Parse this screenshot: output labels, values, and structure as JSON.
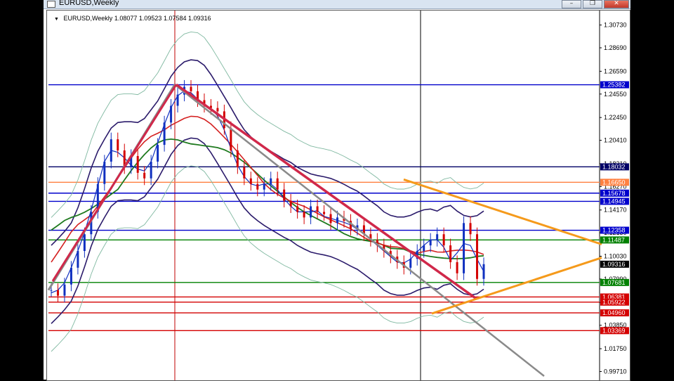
{
  "window": {
    "title": "EURUSD,Weekly",
    "controls": {
      "minimize": "–",
      "maximize": "❐",
      "close": "✕"
    }
  },
  "header": {
    "symbol": "EURUSD,Weekly",
    "open": "1.08077",
    "high": "1.09523",
    "low": "1.07584",
    "close": "1.09316"
  },
  "colors": {
    "levels_blue": "#00008b",
    "levels_red": "#d40000",
    "levels_green": "#007a00",
    "levels_orange": "#ff8040",
    "trend_red": "#d0284a",
    "trend_gray": "#8a8a8a",
    "triangle_orange": "#f59a1b"
  },
  "chart_data": {
    "type": "line",
    "title": "EURUSD,Weekly",
    "xlabel": "",
    "ylabel": "",
    "ylim": [
      0.993,
      1.319
    ],
    "grid": false,
    "y_ticks": [
      "1.30730",
      "1.28690",
      "1.26590",
      "1.24550",
      "1.22450",
      "1.20410",
      "1.18310",
      "1.16270",
      "1.14170",
      "1.12130",
      "1.10030",
      "1.07990",
      "1.05890",
      "1.03850",
      "1.01750",
      "0.99710"
    ],
    "current_price": "1.09316",
    "levels": [
      {
        "label": "1.25382",
        "value": 1.25382,
        "color": "blue"
      },
      {
        "label": "1.18032",
        "value": 1.18032,
        "color": "navy"
      },
      {
        "label": "1.16650",
        "value": 1.1665,
        "color": "orange"
      },
      {
        "label": "1.15678",
        "value": 1.15678,
        "color": "blue"
      },
      {
        "label": "1.14945",
        "value": 1.14945,
        "color": "blue"
      },
      {
        "label": "1.12358",
        "value": 1.12358,
        "color": "blue"
      },
      {
        "label": "1.11487",
        "value": 1.11487,
        "color": "green"
      },
      {
        "label": "1.07681",
        "value": 1.07681,
        "color": "green"
      },
      {
        "label": "1.06381",
        "value": 1.06381,
        "color": "red"
      },
      {
        "label": "1.05922",
        "value": 1.05922,
        "color": "red"
      },
      {
        "label": "1.04960",
        "value": 1.0496,
        "color": "red"
      },
      {
        "label": "1.03369",
        "value": 1.03369,
        "color": "red"
      }
    ],
    "series": [
      {
        "values": [
          1.07,
          1.065,
          1.075,
          1.09,
          1.105,
          1.12,
          1.14,
          1.165,
          1.185,
          1.205,
          1.195,
          1.18,
          1.19,
          1.175,
          1.17,
          1.185,
          1.2,
          1.22,
          1.235,
          1.245,
          1.252,
          1.248,
          1.24,
          1.235,
          1.233,
          1.23,
          1.215,
          1.195,
          1.18,
          1.17,
          1.165,
          1.16,
          1.165,
          1.17,
          1.16,
          1.15,
          1.145,
          1.14,
          1.135,
          1.145,
          1.14,
          1.138,
          1.13,
          1.135,
          1.132,
          1.125,
          1.128,
          1.12,
          1.115,
          1.11,
          1.105,
          1.1,
          1.095,
          1.09,
          1.098,
          1.105,
          1.11,
          1.115,
          1.12,
          1.11,
          1.095,
          1.085,
          1.13,
          1.12,
          1.08,
          1.0932
        ]
      }
    ]
  }
}
